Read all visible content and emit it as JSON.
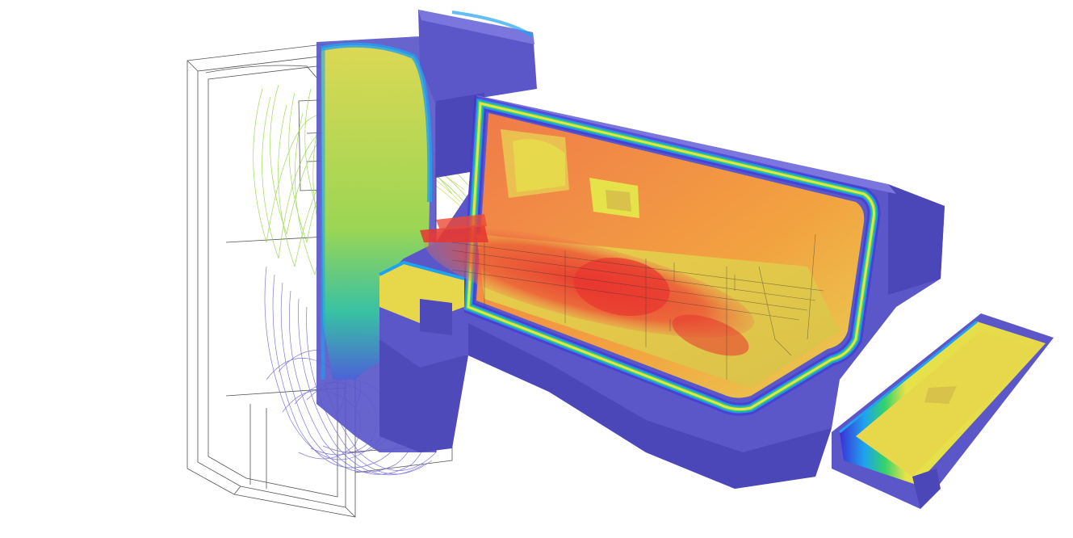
{
  "scene": {
    "subject": "furnace-cfd-simulation",
    "palette": {
      "background": "#ffffff",
      "shell": "#5b57c9",
      "shell_dark": "#3f3ba6",
      "shell_light": "#7a76dd",
      "cold": "#3b2fd6",
      "cool": "#1fa2f0",
      "mid": "#33d36b",
      "warm": "#e6e24a",
      "hot": "#f2a240",
      "hottest": "#e8352f",
      "streamline_blue": "#6a63d8",
      "streamline_green": "#8fd43a",
      "wire": "#555555"
    }
  }
}
